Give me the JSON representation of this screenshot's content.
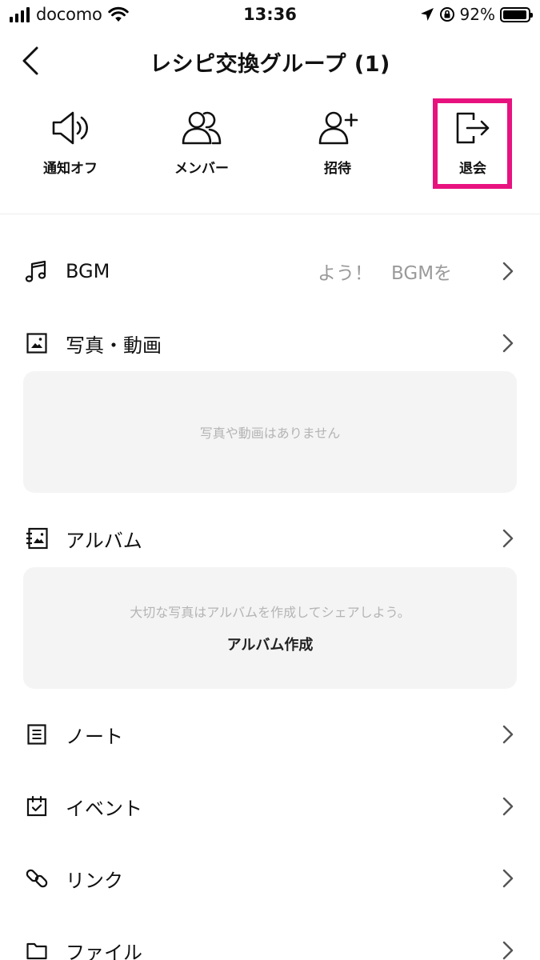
{
  "status_bar": {
    "carrier": "docomo",
    "time": "13:36",
    "battery": "92%"
  },
  "header": {
    "title": "レシピ交換グループ (1)"
  },
  "actions": [
    {
      "label": "通知オフ",
      "icon": "speaker-icon"
    },
    {
      "label": "メンバー",
      "icon": "members-icon"
    },
    {
      "label": "招待",
      "icon": "add-user-icon"
    },
    {
      "label": "退会",
      "icon": "leave-icon"
    }
  ],
  "highlight_color": "#e8127f",
  "menu": {
    "bgm": {
      "label": "BGM",
      "value": "よう！　BGMを"
    },
    "photos": {
      "label": "写真・動画",
      "empty_text": "写真や動画はありません"
    },
    "album": {
      "label": "アルバム",
      "empty_text": "大切な写真はアルバムを作成してシェアしよう。",
      "create_label": "アルバム作成"
    },
    "notes": {
      "label": "ノート"
    },
    "events": {
      "label": "イベント"
    },
    "links": {
      "label": "リンク"
    },
    "files": {
      "label": "ファイル"
    }
  }
}
